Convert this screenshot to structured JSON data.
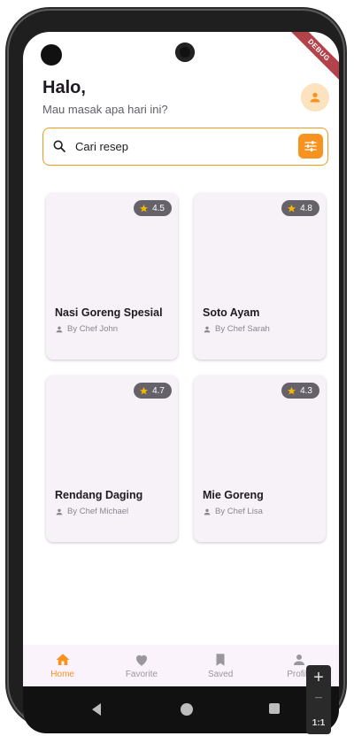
{
  "header": {
    "greeting": "Halo,",
    "subtitle": "Mau masak apa hari ini?"
  },
  "debug_banner": "DEBUG",
  "search": {
    "placeholder": "Cari resep",
    "value": ""
  },
  "recipes": [
    {
      "title": "Nasi Goreng Spesial",
      "author": "By Chef John",
      "rating": "4.5"
    },
    {
      "title": "Soto Ayam",
      "author": "By Chef Sarah",
      "rating": "4.8"
    },
    {
      "title": "Rendang Daging",
      "author": "By Chef Michael",
      "rating": "4.7"
    },
    {
      "title": "Mie Goreng",
      "author": "By Chef Lisa",
      "rating": "4.3"
    }
  ],
  "bottom_nav": [
    {
      "label": "Home",
      "icon": "home-icon",
      "active": true
    },
    {
      "label": "Favorite",
      "icon": "heart-icon",
      "active": false
    },
    {
      "label": "Saved",
      "icon": "bookmark-icon",
      "active": false
    },
    {
      "label": "Profile",
      "icon": "person-icon",
      "active": false
    }
  ],
  "zoom": {
    "plus": "+",
    "minus": "−",
    "ratio": "1:1"
  },
  "colors": {
    "accent": "#f7931e",
    "card_bg": "#f6f2f8",
    "star": "#f5b800"
  }
}
